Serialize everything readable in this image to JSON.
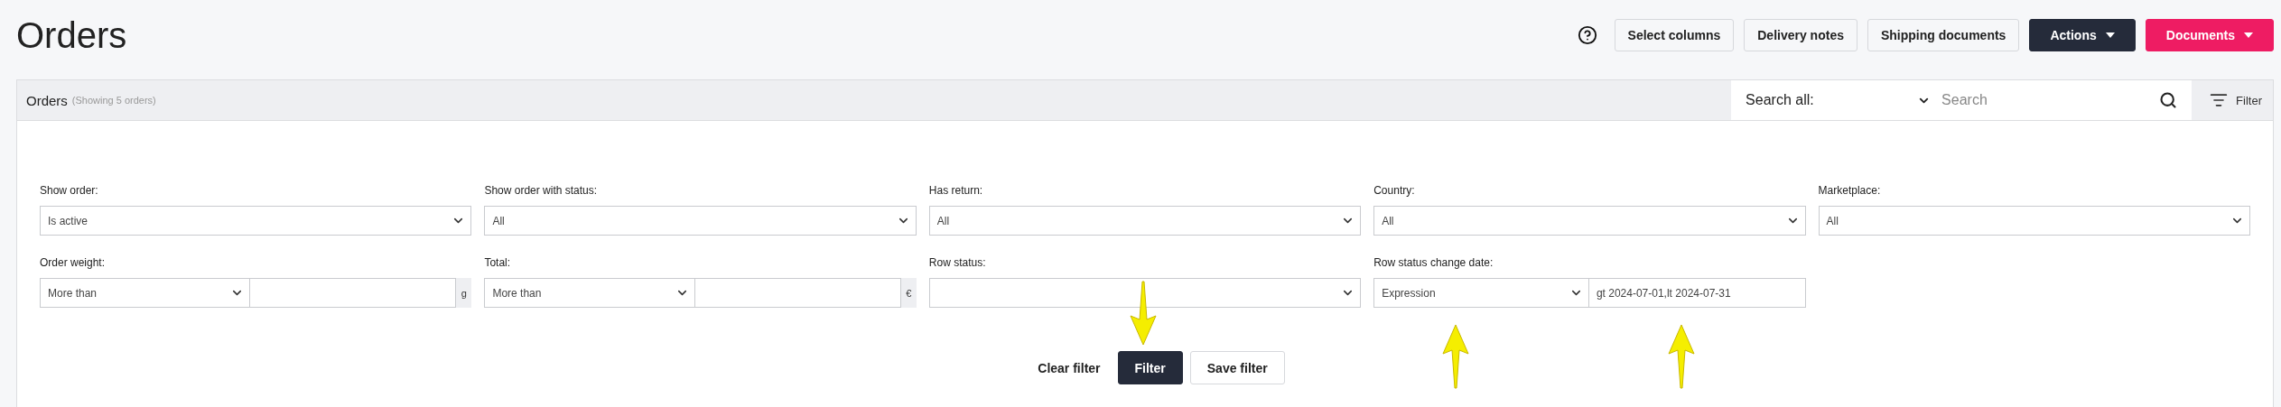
{
  "page_title": "Orders",
  "header_buttons": [
    {
      "label": "Select columns",
      "kind": "outline",
      "dropdown": false
    },
    {
      "label": "Delivery notes",
      "kind": "outline",
      "dropdown": false
    },
    {
      "label": "Shipping documents",
      "kind": "outline",
      "dropdown": false
    },
    {
      "label": "Actions",
      "kind": "dark",
      "dropdown": true
    },
    {
      "label": "Documents",
      "kind": "accent",
      "dropdown": true
    }
  ],
  "panel": {
    "title": "Orders",
    "subtitle": "(Showing 5 orders)",
    "search_scope": "Search all:",
    "search": {
      "placeholder": "Search"
    },
    "filter_button": "Filter"
  },
  "filter_rows": [
    [
      {
        "label": "Show order:",
        "kind": "select",
        "value": "Is active"
      },
      {
        "label": "Show order with status:",
        "kind": "select",
        "value": "All"
      },
      {
        "label": "Has return:",
        "kind": "select",
        "value": "All"
      },
      {
        "label": "Country:",
        "kind": "select",
        "value": "All"
      },
      {
        "label": "Marketplace:",
        "kind": "select",
        "value": "All"
      }
    ],
    [
      {
        "label": "Order weight:",
        "kind": "range",
        "operator": "More than",
        "unit": "g"
      },
      {
        "label": "Total:",
        "kind": "range",
        "operator": "More than",
        "unit": "€"
      },
      {
        "label": "Row status:",
        "kind": "select"
      },
      {
        "label": "Row status change date:",
        "kind": "expression",
        "operator": "Expression",
        "value": "gt 2024-07-01,lt 2024-07-31"
      }
    ]
  ],
  "actions": [
    {
      "label": "Clear filter",
      "kind": "text"
    },
    {
      "label": "Filter",
      "kind": "dark"
    },
    {
      "label": "Save filter",
      "kind": "outline"
    }
  ]
}
